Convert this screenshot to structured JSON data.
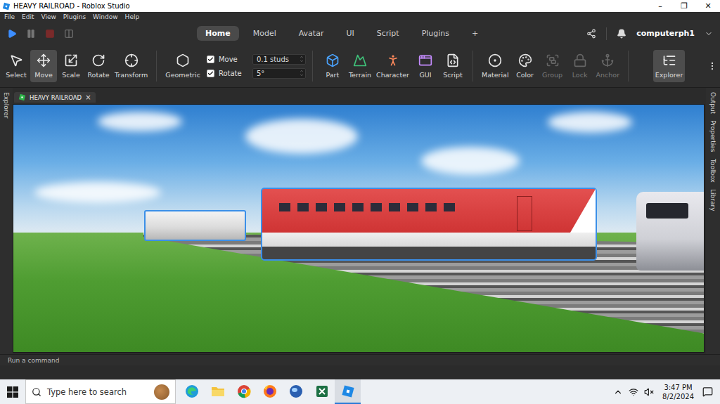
{
  "window": {
    "title": "HEAVY RAILROAD - Roblox Studio",
    "controls": [
      "–",
      "❐",
      "✕"
    ]
  },
  "menu": [
    "File",
    "Edit",
    "View",
    "Plugins",
    "Window",
    "Help"
  ],
  "playback": [
    {
      "disabled": false
    },
    {
      "disabled": true
    },
    {
      "disabled": true
    },
    {
      "disabled": true
    }
  ],
  "ribbon_tabs": [
    {
      "label": "Home",
      "selected": true
    },
    {
      "label": "Model",
      "selected": false
    },
    {
      "label": "Avatar",
      "selected": false
    },
    {
      "label": "UI",
      "selected": false
    },
    {
      "label": "Script",
      "selected": false
    },
    {
      "label": "Plugins",
      "selected": false
    },
    {
      "label": "+",
      "selected": false
    }
  ],
  "user": {
    "name": "computerph1"
  },
  "tools": [
    {
      "label": "Select",
      "selected": false
    },
    {
      "label": "Move",
      "selected": true
    },
    {
      "label": "Scale",
      "selected": false
    },
    {
      "label": "Rotate",
      "selected": false
    },
    {
      "label": "Transform",
      "selected": false
    }
  ],
  "snap": {
    "mode": "Geometric",
    "options": [
      {
        "label": "Move",
        "checked": true,
        "value": "0.1 studs"
      },
      {
        "label": "Rotate",
        "checked": true,
        "value": "5°"
      }
    ]
  },
  "insert": [
    "Part",
    "Terrain",
    "Character",
    "GUI",
    "Script"
  ],
  "edit": [
    {
      "label": "Material",
      "disabled": false
    },
    {
      "label": "Color",
      "disabled": false
    },
    {
      "label": "Group",
      "disabled": true
    },
    {
      "label": "Lock",
      "disabled": true
    },
    {
      "label": "Anchor",
      "disabled": true
    }
  ],
  "explorer_button": {
    "label": "Explorer",
    "selected": true
  },
  "left_dock": [
    "Explorer"
  ],
  "right_dock": [
    "Output",
    "Properties",
    "Toolbox",
    "Library"
  ],
  "document_tab": {
    "label": "HEAVY RAILROAD",
    "close": "×"
  },
  "command_bar": {
    "placeholder": "Run a command"
  },
  "taskbar": {
    "search_placeholder": "Type here to search",
    "time": "3:47 PM",
    "date": "8/2/2024",
    "apps": [
      {
        "selected": false
      },
      {
        "selected": false
      },
      {
        "selected": false
      },
      {
        "selected": false
      },
      {
        "selected": false
      },
      {
        "selected": false
      },
      {
        "selected": true
      }
    ]
  }
}
